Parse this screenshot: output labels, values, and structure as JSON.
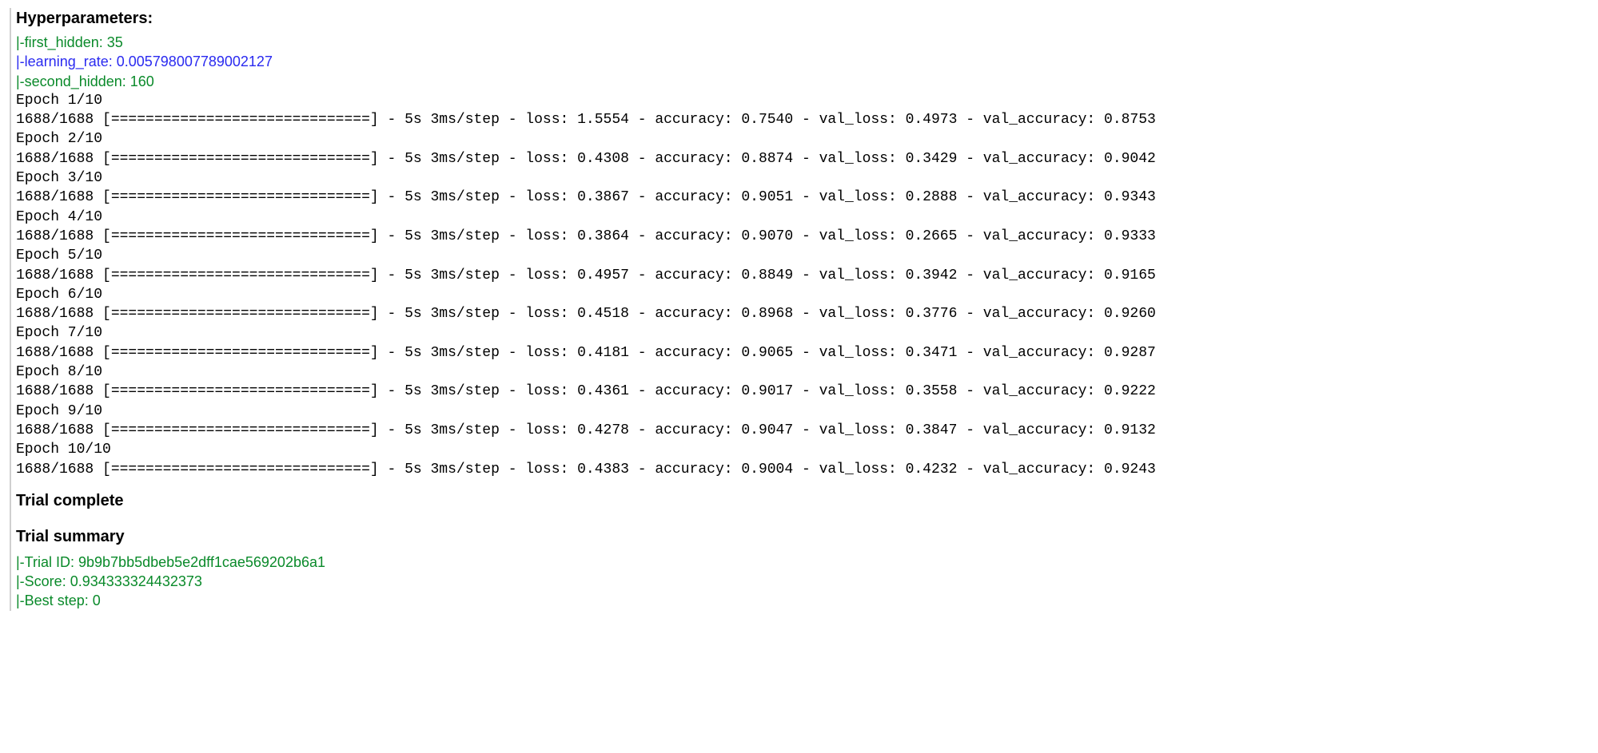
{
  "headings": {
    "hyperparameters": "Hyperparameters:",
    "trial_complete": "Trial complete",
    "trial_summary": "Trial summary"
  },
  "hyperparameters": {
    "first_hidden_label": "|-first_hidden: 35",
    "learning_rate_label": "|-learning_rate: 0.005798007789002127",
    "second_hidden_label": "|-second_hidden: 160"
  },
  "training": {
    "steps_total": "1688",
    "bar": "[==============================]",
    "time": "5s 3ms/step",
    "epochs": [
      {
        "label": "Epoch 1/10",
        "loss": "1.5554",
        "accuracy": "0.7540",
        "val_loss": "0.4973",
        "val_accuracy": "0.8753"
      },
      {
        "label": "Epoch 2/10",
        "loss": "0.4308",
        "accuracy": "0.8874",
        "val_loss": "0.3429",
        "val_accuracy": "0.9042"
      },
      {
        "label": "Epoch 3/10",
        "loss": "0.3867",
        "accuracy": "0.9051",
        "val_loss": "0.2888",
        "val_accuracy": "0.9343"
      },
      {
        "label": "Epoch 4/10",
        "loss": "0.3864",
        "accuracy": "0.9070",
        "val_loss": "0.2665",
        "val_accuracy": "0.9333"
      },
      {
        "label": "Epoch 5/10",
        "loss": "0.4957",
        "accuracy": "0.8849",
        "val_loss": "0.3942",
        "val_accuracy": "0.9165"
      },
      {
        "label": "Epoch 6/10",
        "loss": "0.4518",
        "accuracy": "0.8968",
        "val_loss": "0.3776",
        "val_accuracy": "0.9260"
      },
      {
        "label": "Epoch 7/10",
        "loss": "0.4181",
        "accuracy": "0.9065",
        "val_loss": "0.3471",
        "val_accuracy": "0.9287"
      },
      {
        "label": "Epoch 8/10",
        "loss": "0.4361",
        "accuracy": "0.9017",
        "val_loss": "0.3558",
        "val_accuracy": "0.9222"
      },
      {
        "label": "Epoch 9/10",
        "loss": "0.4278",
        "accuracy": "0.9047",
        "val_loss": "0.3847",
        "val_accuracy": "0.9132"
      },
      {
        "label": "Epoch 10/10",
        "loss": "0.4383",
        "accuracy": "0.9004",
        "val_loss": "0.4232",
        "val_accuracy": "0.9243"
      }
    ]
  },
  "summary": {
    "trial_id_label": "|-Trial ID: 9b9b7bb5dbeb5e2dff1cae569202b6a1",
    "score_label": "|-Score: 0.934333324432373",
    "best_step_label": "|-Best step: 0"
  }
}
